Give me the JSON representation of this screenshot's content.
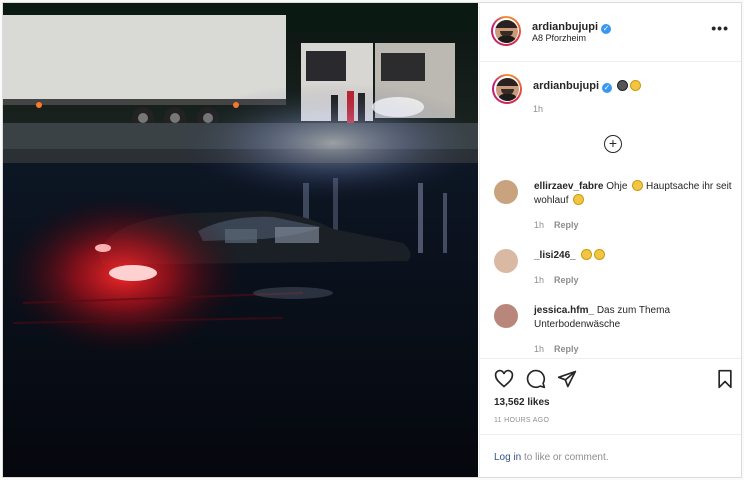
{
  "post": {
    "author": "ardianbujupi",
    "location": "A8 Pforzheim",
    "caption_time": "1h",
    "likes": "13,562 likes",
    "posted_ago": "11 HOURS AGO"
  },
  "photo": {
    "description_icon": "flooded-car-photo"
  },
  "comments": [
    {
      "username": "ellirzaev_fabre",
      "text": "Ohje",
      "text2": "Hauptsache ihr seit wohlauf",
      "time": "1h",
      "reply": "Reply"
    },
    {
      "username": "_lisi246_",
      "text": "",
      "time": "1h",
      "reply": "Reply"
    },
    {
      "username": "jessica.hfm_",
      "text": "Das zum Thema Unterbodenwäsche",
      "time": "1h",
      "reply": "Reply"
    }
  ],
  "footer": {
    "login_link": "Log in",
    "login_rest": "to like or comment."
  },
  "colors": {
    "verified": "#3897f0",
    "link": "#385185",
    "muted": "#8e8e8e"
  }
}
